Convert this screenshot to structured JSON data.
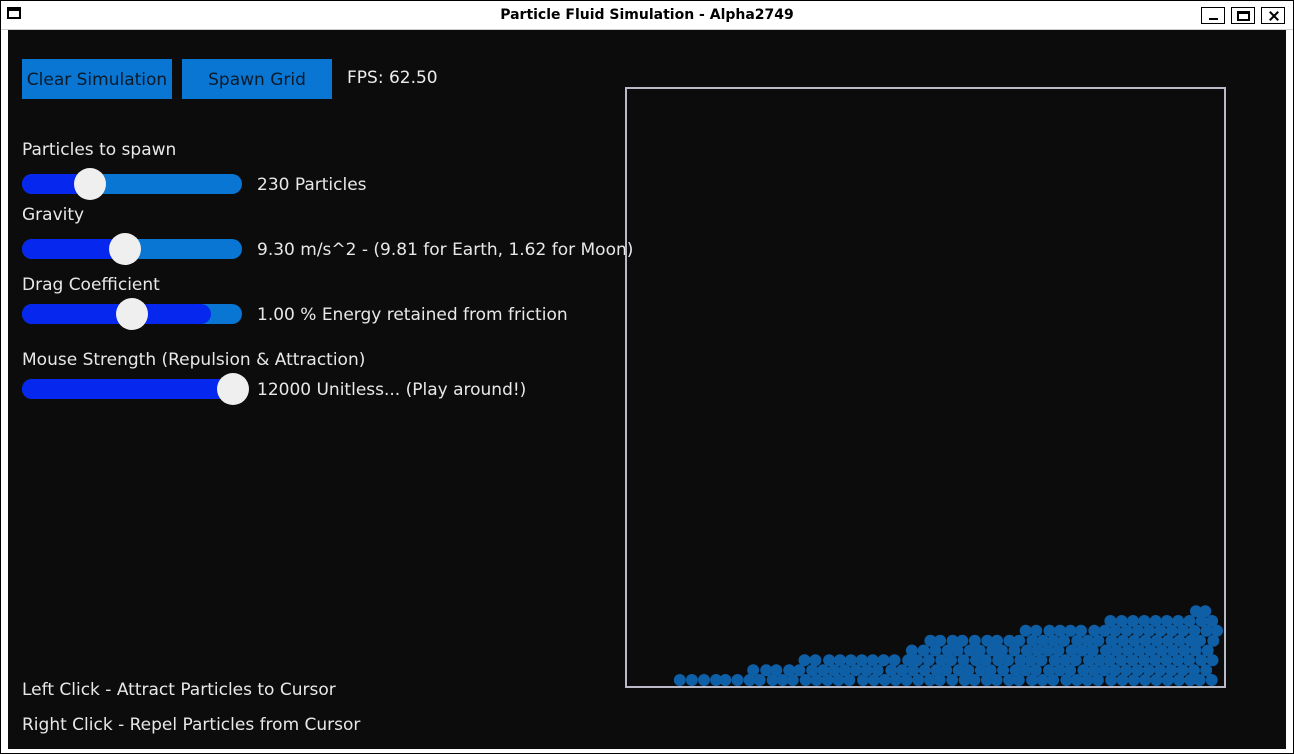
{
  "window": {
    "title": "Particle Fluid Simulation - Alpha2749"
  },
  "toolbar": {
    "clear_label": "Clear Simulation",
    "spawn_label": "Spawn Grid",
    "fps": "FPS: 62.50"
  },
  "controls": [
    {
      "label": "Particles to spawn",
      "value_text": "230 Particles",
      "level": 0.31
    },
    {
      "label": "Gravity",
      "value_text": "9.30 m/s^2 - (9.81 for Earth, 1.62 for Moon)",
      "level": 0.47
    },
    {
      "label": "Drag Coefficient",
      "value_text": "1.00 % Energy retained from friction",
      "level": 0.5,
      "fill": 0.86
    },
    {
      "label": "Mouse Strength (Repulsion & Attraction)",
      "value_text": "12000 Unitless... (Play around!)",
      "level": 0.96
    }
  ],
  "help": {
    "left_click": "Left Click - Attract Particles to Cursor",
    "right_click": "Right Click - Repel Particles from Cursor"
  },
  "colors": {
    "background": "#0c0c0d",
    "button": "#0876d2",
    "slider_fill": "#0527ee",
    "particle": "#0e5fa6",
    "box_border": "#b9b9c8"
  }
}
